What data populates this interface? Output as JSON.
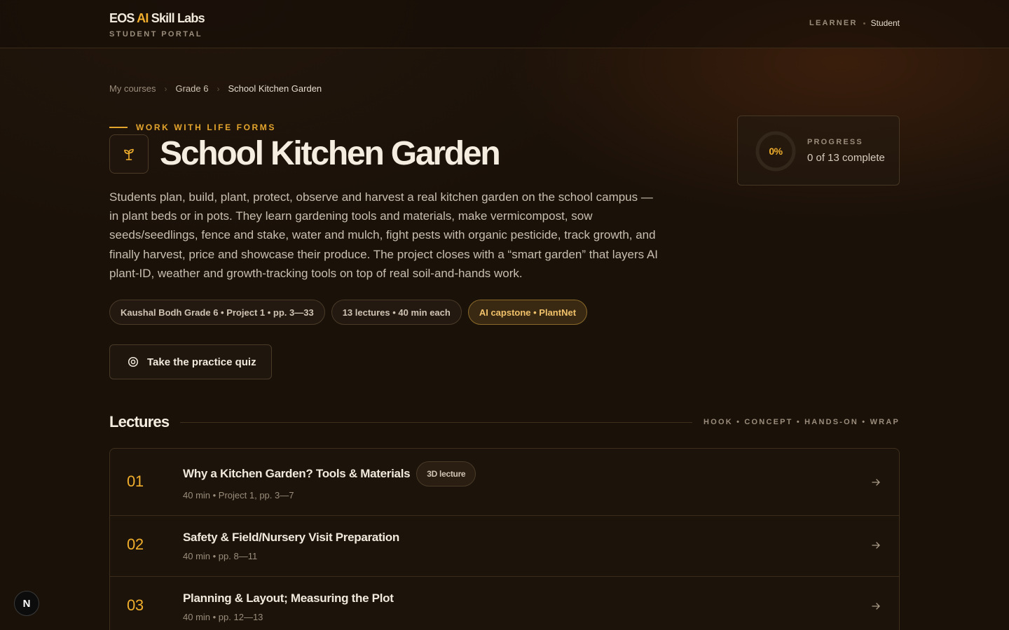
{
  "header": {
    "brand_pre": "EOS ",
    "brand_ai": "AI",
    "brand_post": " Skill Labs",
    "brand_sub": "STUDENT PORTAL",
    "user_role": "LEARNER",
    "user_name": "Student"
  },
  "breadcrumb": {
    "items": [
      "My courses",
      "Grade 6",
      "School Kitchen Garden"
    ]
  },
  "hero": {
    "eyebrow": "WORK WITH LIFE FORMS",
    "title": "School Kitchen Garden",
    "icon": "sprout-icon",
    "description": "Students plan, build, plant, protect, observe and harvest a real kitchen garden on the school campus — in plant beds or in pots. They learn gardening tools and materials, make vermicompost, sow seeds/seedlings, fence and stake, water and mulch, fight pests with organic pesticide, track growth, and finally harvest, price and showcase their produce. The project closes with a “smart garden” that layers AI plant-ID, weather and growth-tracking tools on top of real soil-and-hands work.",
    "tags": [
      "Kaushal Bodh Grade 6 • Project 1 • pp. 3—33",
      "13 lectures • 40 min each",
      "AI capstone • PlantNet"
    ],
    "quiz_button": "Take the practice quiz"
  },
  "progress": {
    "percent_label": "0%",
    "percent": 0,
    "label": "PROGRESS",
    "value": "0 of 13 complete"
  },
  "lectures": {
    "title": "Lectures",
    "phases": "HOOK • CONCEPT • HANDS-ON • WRAP",
    "items": [
      {
        "number": "01",
        "title": "Why a Kitchen Garden? Tools & Materials",
        "badge": "3D lecture",
        "meta": "40 min • Project 1, pp. 3—7"
      },
      {
        "number": "02",
        "title": "Safety & Field/Nursery Visit Preparation",
        "meta": "40 min • pp. 8—11"
      },
      {
        "number": "03",
        "title": "Planning & Layout; Measuring the Plot",
        "meta": "40 min • pp. 12—13"
      }
    ]
  },
  "dev_badge": "N",
  "colors": {
    "accent": "#f0ae2c",
    "background": "#1a1109"
  }
}
